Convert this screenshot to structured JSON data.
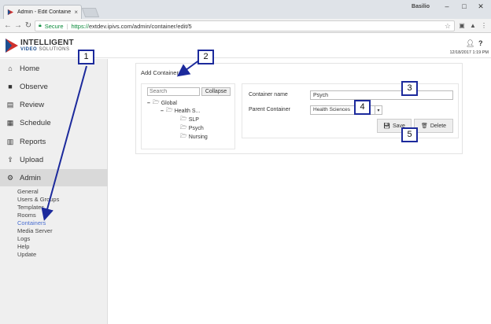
{
  "browser": {
    "tab_title": "Admin - Edit Container",
    "tab_close": "×",
    "user_name": "Basilio",
    "url_secure_label": "Secure",
    "url_scheme": "https://",
    "url_rest": "extdev.ipivs.com/admin/container/edit/5",
    "minimize": "–",
    "maximize": "□",
    "close": "✕"
  },
  "header": {
    "logo_line1": "INTELLIGENT",
    "logo_line2_v": "VIDEO",
    "logo_line2_rest": " SOLUTIONS",
    "date": "12/18/2017 1:19 PM"
  },
  "sidebar": {
    "items": [
      {
        "label": "Home",
        "icon": "⌂"
      },
      {
        "label": "Observe",
        "icon": "■"
      },
      {
        "label": "Review",
        "icon": "▤"
      },
      {
        "label": "Schedule",
        "icon": "▦"
      },
      {
        "label": "Reports",
        "icon": "▥"
      },
      {
        "label": "Upload",
        "icon": "⇪"
      },
      {
        "label": "Admin",
        "icon": "⚙"
      }
    ],
    "submenu": [
      "General",
      "Users & Groups",
      "Templates",
      "Rooms",
      "Containers",
      "Media Server",
      "Logs",
      "Help",
      "Update"
    ]
  },
  "main": {
    "title": "Add Container",
    "search_placeholder": "Search",
    "collapse_label": "Collapse",
    "tree": {
      "global": "Global",
      "health": "Health S...",
      "slp": "SLP",
      "psych": "Psych",
      "nursing": "Nursing"
    },
    "form": {
      "name_label": "Container name",
      "name_value": "Psych",
      "parent_label": "Parent Container",
      "parent_value": "Health Sciences",
      "save_label": "Save",
      "delete_label": "Delete"
    }
  },
  "callouts": [
    "1",
    "2",
    "3",
    "4",
    "5"
  ],
  "colors": {
    "callout_border": "#1c2a9c",
    "link_active": "#4a6fd1",
    "secure_green": "#0a8a3a"
  }
}
